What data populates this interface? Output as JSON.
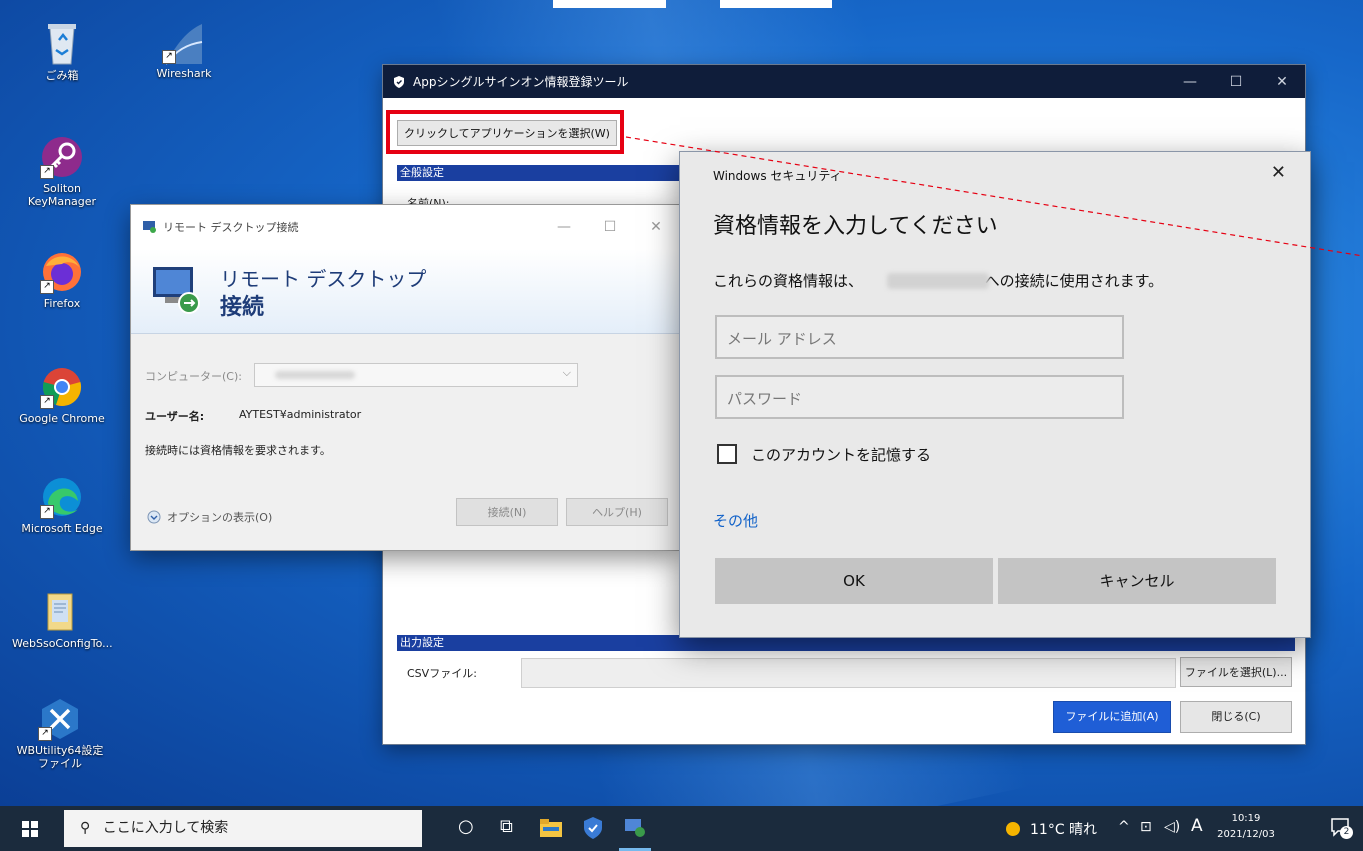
{
  "desktop_icons": [
    {
      "label": "ごみ箱"
    },
    {
      "label": "Wireshark"
    },
    {
      "label": "Soliton KeyManager"
    },
    {
      "label": "Firefox"
    },
    {
      "label": "Google Chrome"
    },
    {
      "label": "Microsoft Edge"
    },
    {
      "label": "WebSsoConfigTo..."
    },
    {
      "label": "WBUtility64設定ファイル"
    }
  ],
  "app_window": {
    "title": "Appシングルサインオン情報登録ツール",
    "select_button": "クリックしてアプリケーションを選択(W)",
    "general_section": "全般設定",
    "name_label": "名前(N):",
    "output_section": "出力設定",
    "csv_label": "CSVファイル:",
    "choose_file_button": "ファイルを選択(L)...",
    "add_to_file_button": "ファイルに追加(A)",
    "close_button": "閉じる(C)"
  },
  "rdp_window": {
    "title": "リモート デスクトップ接続",
    "heading_line1": "リモート デスクトップ",
    "heading_line2": "接続",
    "computer_label": "コンピューター(C):",
    "user_label": "ユーザー名:",
    "user_value": "AYTEST¥administrator",
    "prompt_text": "接続時には資格情報を要求されます。",
    "options_link": "オプションの表示(O)",
    "connect_button": "接続(N)",
    "help_button": "ヘルプ(H)"
  },
  "security_dialog": {
    "header": "Windows セキュリティ",
    "title": "資格情報を入力してください",
    "desc_prefix": "これらの資格情報は、",
    "desc_suffix": "への接続に使用されます。",
    "email_placeholder": "メール アドレス",
    "password_placeholder": "パスワード",
    "remember_label": "このアカウントを記憶する",
    "more_link": "その他",
    "ok_button": "OK",
    "cancel_button": "キャンセル"
  },
  "taskbar": {
    "search_placeholder": "ここに入力して検索",
    "weather": "11°C 晴れ",
    "ime": "A",
    "time": "10:19",
    "date": "2021/12/03",
    "notification_count": "2"
  },
  "colors": {
    "app_titlebar": "#0f1d3a",
    "section_bar": "#1a3fa0",
    "highlight_red": "#e60012",
    "primary_button": "#1f5ed6",
    "taskbar": "#1b2b3d",
    "link": "#1363c9"
  }
}
